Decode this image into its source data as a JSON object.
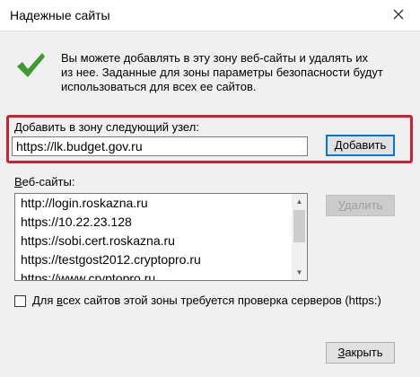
{
  "window": {
    "title": "Надежные сайты"
  },
  "info": {
    "lines": [
      "Вы можете добавлять в эту зону  веб-сайты и удалять их",
      "из нее. Заданные для зоны параметры безопасности будут",
      "использоваться для всех ее сайтов."
    ]
  },
  "add": {
    "label_key": "Д",
    "label_rest": "обавить в зону следующий узел:",
    "value": "https://lk.budget.gov.ru",
    "button_key": "Д",
    "button_rest": "обавить"
  },
  "sites": {
    "label_key": "В",
    "label_rest": "еб-сайты:",
    "items": [
      "http://login.roskazna.ru",
      "https://10.22.23.128",
      "https://sobi.cert.roskazna.ru",
      "https://testgost2012.cryptopro.ru",
      "https://www.cryptopro.ru"
    ]
  },
  "remove": {
    "key": "У",
    "rest": "далить"
  },
  "https_check": {
    "pre": "Для ",
    "key": "в",
    "rest": "сех сайтов этой зоны требуется проверка серверов (https:)",
    "checked": false
  },
  "close": {
    "key": "З",
    "rest": "акрыть"
  },
  "colors": {
    "accent": "#0078d7",
    "highlight_box": "#d01f2f",
    "checkmark": "#3c9a2f"
  },
  "icons": [
    "close-icon",
    "checkmark-icon",
    "scroll-up-icon",
    "scroll-down-icon"
  ]
}
